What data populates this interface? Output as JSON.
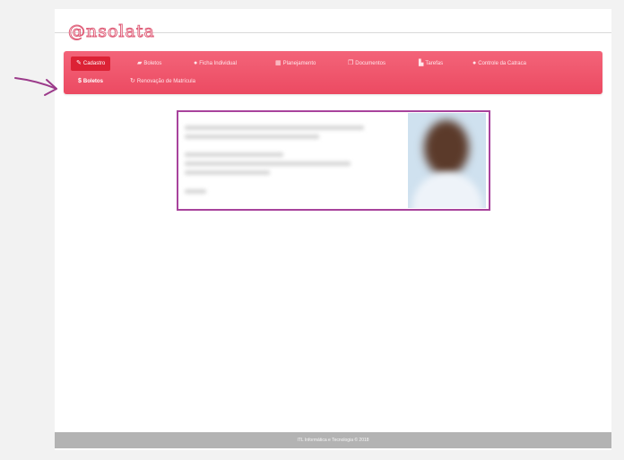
{
  "brand": {
    "logo_text": "@nsolata"
  },
  "nav": {
    "row1": [
      {
        "label": "Cadastro",
        "icon": "edit-icon",
        "glyph": "✎"
      },
      {
        "label": "Boletos",
        "icon": "tickets-icon",
        "glyph": "▰"
      },
      {
        "label": "Ficha Individual",
        "icon": "comment-icon",
        "glyph": "●"
      },
      {
        "label": "Planejamento",
        "icon": "table-icon",
        "glyph": "▦"
      },
      {
        "label": "Documentos",
        "icon": "files-icon",
        "glyph": "❐"
      },
      {
        "label": "Tarefas",
        "icon": "file-icon",
        "glyph": "▙"
      },
      {
        "label": "Controle da Catraca",
        "icon": "info-icon",
        "glyph": "●"
      }
    ],
    "row2": [
      {
        "label": "Boletos",
        "icon": "dollar-icon",
        "glyph": "$"
      },
      {
        "label": "Renovação de Matrícula",
        "icon": "refresh-icon",
        "glyph": "↻"
      }
    ]
  },
  "footer": {
    "text": "ITL Informática e Tecnologia © 2018"
  },
  "colors": {
    "navbar": "#f05a70",
    "active": "#dc2235",
    "highlight": "#a8439c",
    "arrow": "#9b3a8a"
  }
}
